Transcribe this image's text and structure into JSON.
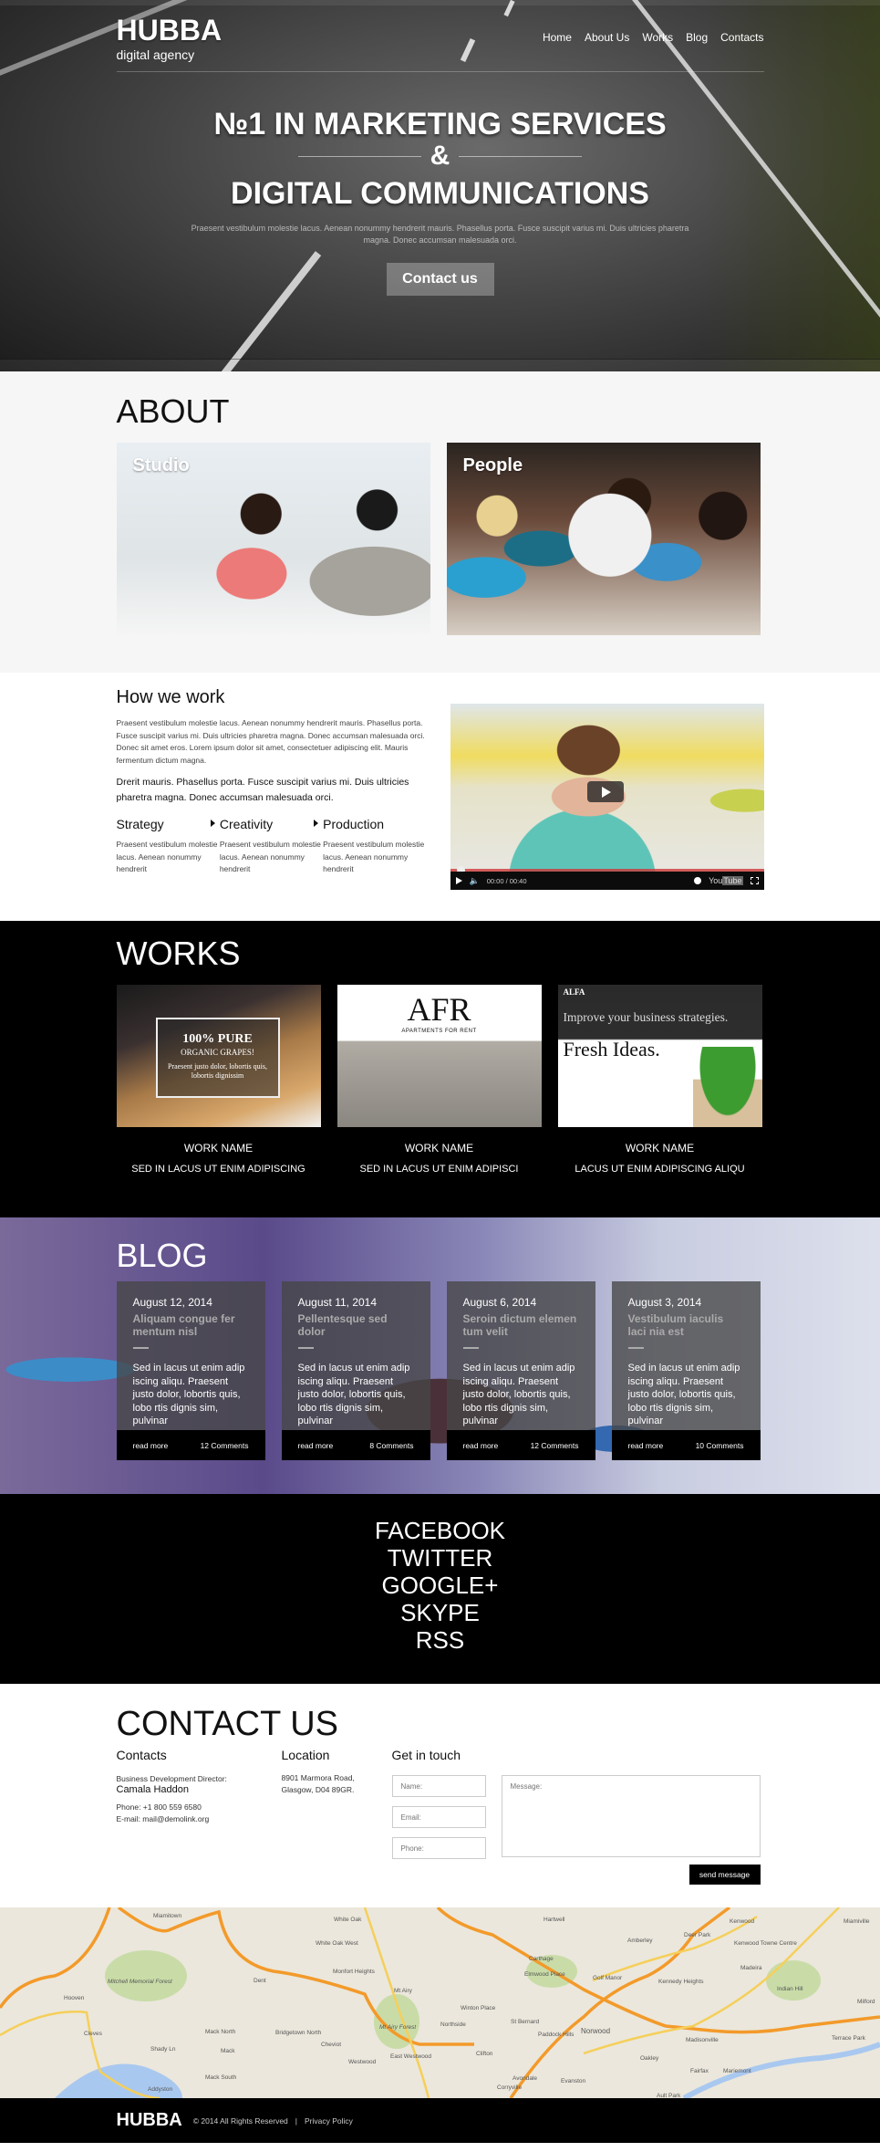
{
  "header": {
    "logo": "HUBBA",
    "tagline": "digital agency",
    "nav": [
      "Home",
      "About Us",
      "Works",
      "Blog",
      "Contacts"
    ]
  },
  "hero": {
    "title_line1": "№1 IN MARKETING SERVICES",
    "ampersand": "&",
    "title_line2": "DIGITAL COMMUNICATIONS",
    "text": "Praesent vestibulum molestie lacus. Aenean nonummy hendrerit mauris. Phasellus porta. Fusce suscipit varius mi. Duis ultricies pharetra magna. Donec accumsan malesuada orci.",
    "button": "Contact us"
  },
  "about": {
    "heading": "ABOUT",
    "cards": [
      {
        "label": "Studio"
      },
      {
        "label": "People"
      }
    ]
  },
  "how": {
    "heading": "How we work",
    "paragraph": "Praesent vestibulum molestie lacus. Aenean nonummy hendrerit mauris. Phasellus porta. Fusce suscipit varius mi. Duis ultricies pharetra magna. Donec accumsan malesuada orci. Donec sit amet eros. Lorem ipsum dolor sit amet, consectetuer adipiscing elit. Mauris fermentum dictum magna.",
    "lead": "Drerit mauris. Phasellus porta. Fusce suscipit varius mi. Duis ultricies pharetra magna. Donec accumsan malesuada orci.",
    "steps": [
      {
        "title": "Strategy",
        "text": "Praesent vestibulum molestie lacus. Aenean nonummy hendrerit"
      },
      {
        "title": "Creativity",
        "text": "Praesent vestibulum molestie lacus. Aenean nonummy hendrerit"
      },
      {
        "title": "Production",
        "text": "Praesent vestibulum molestie lacus. Aenean nonummy hendrerit"
      }
    ],
    "video": {
      "time": "00:00 / 00:40",
      "brand_you": "You",
      "brand_tube": "Tube",
      "progress_percent": 0
    }
  },
  "works": {
    "heading": "WORKS",
    "items": [
      {
        "name": "WORK NAME",
        "sub": "SED IN LACUS UT ENIM ADIPISCING",
        "thumb_line1": "100% PURE",
        "thumb_line2": "ORGANIC GRAPES!",
        "thumb_line3": "Praesent justo dolor, lobortis quis, lobortis dignissim"
      },
      {
        "name": "WORK NAME",
        "sub": "SED IN LACUS UT ENIM ADIPISCI",
        "thumb_line1": "AFR",
        "thumb_line2": "APARTMENTS FOR RENT"
      },
      {
        "name": "WORK NAME",
        "sub": "LACUS UT ENIM ADIPISCING ALIQU",
        "thumb_line1": "ALFA",
        "thumb_line2": "Improve your business strategies.",
        "thumb_line3": "Fresh Ideas."
      }
    ]
  },
  "blog": {
    "heading": "BLOG",
    "posts": [
      {
        "date": "August 12, 2014",
        "title": "Aliquam congue fer mentum nisl",
        "excerpt": "Sed in lacus ut enim adip iscing aliqu. Praesent justo dolor, lobortis quis, lobo rtis dignis sim, pulvinar",
        "read_more": "read more",
        "comments": "12 Comments"
      },
      {
        "date": "August 11, 2014",
        "title": "Pellentesque sed dolor",
        "excerpt": "Sed in lacus ut enim adip iscing aliqu. Praesent justo dolor, lobortis quis, lobo rtis dignis sim, pulvinar",
        "read_more": "read more",
        "comments": "8 Comments"
      },
      {
        "date": "August 6, 2014",
        "title": "Seroin dictum elemen tum velit",
        "excerpt": "Sed in lacus ut enim adip iscing aliqu. Praesent justo dolor, lobortis quis, lobo rtis dignis sim, pulvinar",
        "read_more": "read more",
        "comments": "12 Comments"
      },
      {
        "date": "August 3, 2014",
        "title": "Vestibulum iaculis laci nia est",
        "excerpt": "Sed in lacus ut enim adip iscing aliqu. Praesent justo dolor, lobortis quis, lobo rtis dignis sim, pulvinar",
        "read_more": "read more",
        "comments": "10 Comments"
      }
    ]
  },
  "social": [
    "FACEBOOK",
    "TWITTER",
    "GOOGLE+",
    "SKYPE",
    "RSS"
  ],
  "contact": {
    "heading": "CONTACT US",
    "contacts_heading": "Contacts",
    "role": "Business Development Director:",
    "person": "Camala Haddon",
    "phone": "Phone:  +1 800 559 6580",
    "email": "E-mail: mail@demolink.org",
    "location_heading": "Location",
    "address_line1": "8901 Marmora Road,",
    "address_line2": "Glasgow, D04 89GR.",
    "form_heading": "Get in touch",
    "name_placeholder": "Name:",
    "email_placeholder": "Email:",
    "phone_placeholder": "Phone:",
    "message_placeholder": "Message:",
    "send_button": "send message"
  },
  "map": {
    "labels": [
      "Miamitown",
      "Mitchell Memorial Forest",
      "Hooven",
      "Cleves",
      "Shady Ln",
      "Mack North",
      "Mack",
      "Mack South",
      "Addyston",
      "Dent",
      "Bridgetown North",
      "Cheviot",
      "Westwood",
      "East Westwood",
      "White Oak",
      "White Oak West",
      "Monfort Heights",
      "Mt Airy",
      "Mt Airy Forest",
      "Hartwell",
      "Carthage",
      "Elmwood Place",
      "Winton Place",
      "Northside",
      "St Bernard",
      "Paddock Hills",
      "Clifton",
      "Avondale",
      "Corryville",
      "Evanston",
      "Norwood",
      "Golf Manor",
      "Amberley",
      "Kennedy Heights",
      "Oakley",
      "Madisonville",
      "Fairfax",
      "Mariemont",
      "Ault Park",
      "Deer Park",
      "Kenwood",
      "Kenwood Towne Centre",
      "Madeira",
      "Indian Hill",
      "Terrace Park",
      "Milford",
      "Miamiville"
    ]
  },
  "footer": {
    "logo": "HUBBA",
    "copyright": "© 2014 All Rights Reserved",
    "separator": "|",
    "privacy": "Privacy Policy"
  },
  "colors": {
    "primary": "#000000",
    "about_bg": "#f6f6f6",
    "blog_title": "#aaaaaa",
    "map_road": "#f39a2a"
  }
}
